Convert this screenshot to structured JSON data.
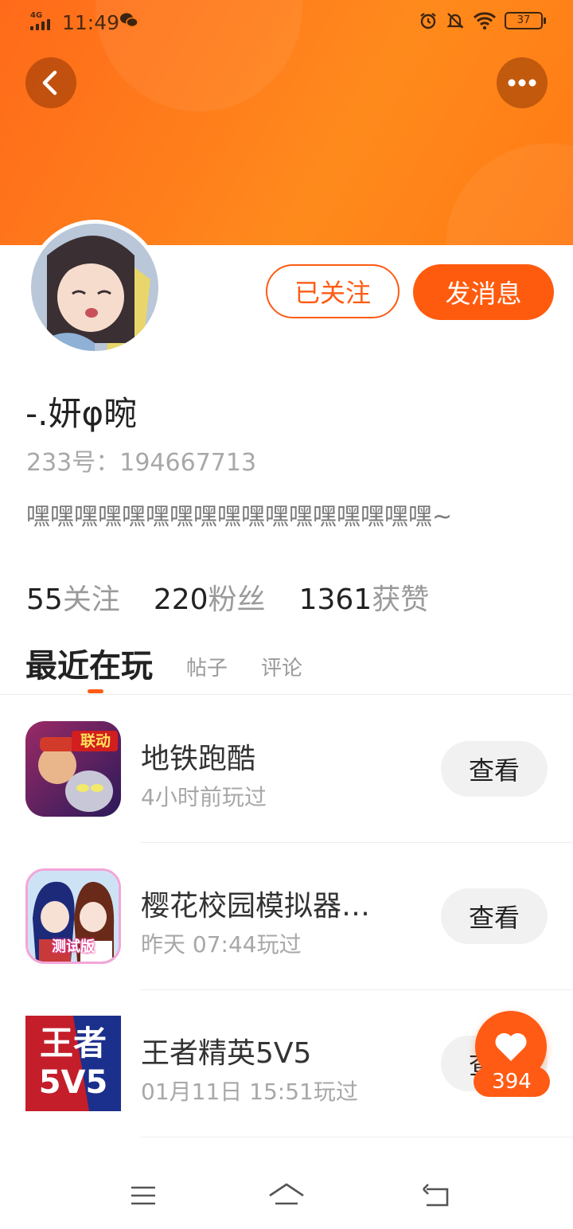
{
  "status_bar": {
    "network": "4G",
    "time": "11:49",
    "battery": "37"
  },
  "colors": {
    "accent": "#ff5b14",
    "header": "#ff7a14"
  },
  "header": {
    "back_icon": "chevron-left-icon",
    "more_icon": "more-horizontal-icon"
  },
  "profile": {
    "followed_label": "已关注",
    "message_label": "发消息",
    "username": "-.妍φ晼",
    "uid": "233号：194667713",
    "bio": "嘿嘿嘿嘿嘿嘿嘿嘿嘿嘿嘿嘿嘿嘿嘿嘿嘿~"
  },
  "stats": [
    {
      "num": "55",
      "label": "关注"
    },
    {
      "num": "220",
      "label": "粉丝"
    },
    {
      "num": "1361",
      "label": "获赞"
    }
  ],
  "tabs": {
    "active": "最近在玩",
    "posts": "帖子",
    "comments": "评论"
  },
  "games": [
    {
      "title": "地铁跑酷",
      "sub": "4小时前玩过",
      "action": "查看"
    },
    {
      "title": "樱花校园模拟器…",
      "sub": "昨天 07:44玩过",
      "action": "查看"
    },
    {
      "title": "王者精英5V5",
      "sub": "01月11日 15:51玩过",
      "action": "查看"
    }
  ],
  "icon_text": {
    "game1_badge": "联动",
    "game2_badge": "测试版",
    "game3_top": "王者",
    "game3_bottom": "5V5"
  },
  "fab": {
    "icon": "heart-icon",
    "count": "394"
  },
  "nav": {
    "menu": "menu-icon",
    "home": "home-icon",
    "back": "back-icon"
  }
}
